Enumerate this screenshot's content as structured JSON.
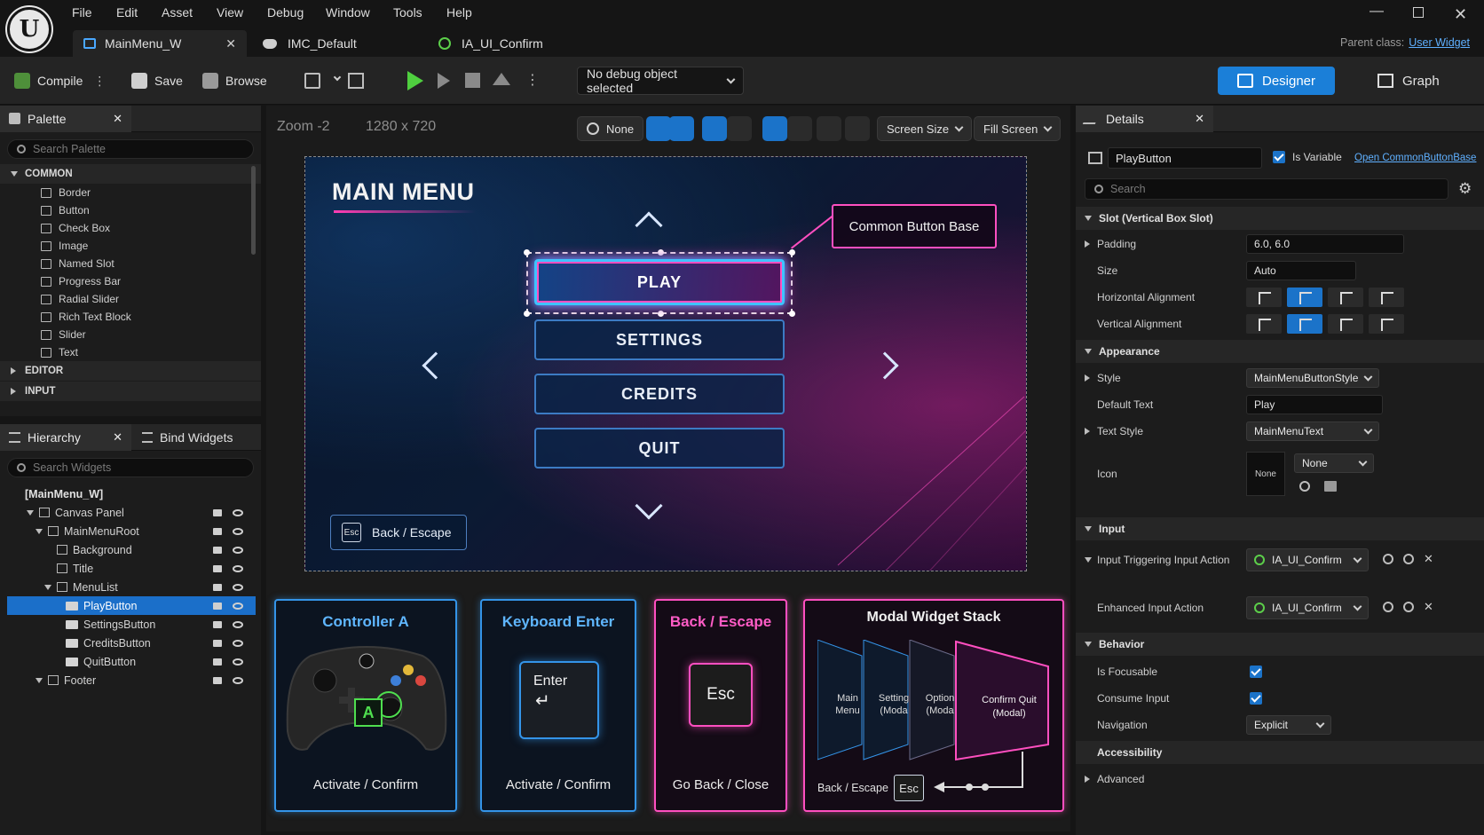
{
  "menu": [
    "File",
    "Edit",
    "Asset",
    "View",
    "Debug",
    "Window",
    "Tools",
    "Help"
  ],
  "tabs": [
    {
      "label": "MainMenu_W",
      "active": true
    },
    {
      "label": "IMC_Default"
    },
    {
      "label": "IA_UI_Confirm"
    }
  ],
  "parent_class": {
    "label": "Parent class:",
    "value": "User Widget"
  },
  "toolbar": {
    "compile": "Compile",
    "save": "Save",
    "browse": "Browse",
    "debug_select": "No debug object selected",
    "designer": "Designer",
    "graph": "Graph"
  },
  "palette": {
    "title": "Palette",
    "search_placeholder": "Search Palette",
    "categories": [
      {
        "name": "COMMON",
        "items": [
          "Border",
          "Button",
          "Check Box",
          "Image",
          "Named Slot",
          "Progress Bar",
          "Radial Slider",
          "Rich Text Block",
          "Slider",
          "Text"
        ]
      },
      {
        "name": "EDITOR"
      },
      {
        "name": "INPUT"
      }
    ]
  },
  "hierarchy": {
    "title": "Hierarchy",
    "bind_tab": "Bind Widgets",
    "search_placeholder": "Search Widgets",
    "root": "[MainMenu_W]",
    "rows": [
      {
        "label": "Canvas Panel",
        "depth": 1
      },
      {
        "label": "MainMenuRoot",
        "depth": 2
      },
      {
        "label": "Background",
        "depth": 3
      },
      {
        "label": "Title",
        "depth": 3
      },
      {
        "label": "MenuList",
        "depth": 3
      },
      {
        "label": "PlayButton",
        "depth": 4,
        "selected": true
      },
      {
        "label": "SettingsButton",
        "depth": 4
      },
      {
        "label": "CreditsButton",
        "depth": 4
      },
      {
        "label": "QuitButton",
        "depth": 4
      },
      {
        "label": "Footer",
        "depth": 2
      }
    ]
  },
  "viewport": {
    "zoom": "Zoom -2",
    "resolution": "1280 x 720",
    "none_label": "None",
    "screen_size": "Screen Size",
    "fill_screen": "Fill Screen"
  },
  "canvas": {
    "title": "MAIN MENU",
    "buttons": [
      "PLAY",
      "SETTINGS",
      "CREDITS",
      "QUIT"
    ],
    "callout": "Common Button Base",
    "back_key": "Esc",
    "back_label": "Back / Escape"
  },
  "cards": {
    "controller": {
      "title": "Controller A",
      "key": "A",
      "caption": "Activate / Confirm"
    },
    "keyboard": {
      "title": "Keyboard Enter",
      "key": "Enter",
      "caption": "Activate / Confirm"
    },
    "back": {
      "title": "Back / Escape",
      "key": "Esc",
      "caption": "Go Back / Close"
    },
    "modal": {
      "title": "Modal Widget Stack",
      "layers": [
        "Main Menu",
        "Setting (Moda",
        "Option (Moda",
        "Confirm Quit (Modal)"
      ],
      "footer_label": "Back / Escape",
      "footer_key": "Esc"
    }
  },
  "details": {
    "title": "Details",
    "widget_name": "PlayButton",
    "is_variable": "Is Variable",
    "open_link": "Open CommonButtonBase",
    "search_placeholder": "Search",
    "slot_category": "Slot (Vertical Box Slot)",
    "padding": {
      "label": "Padding",
      "value": "6.0, 6.0"
    },
    "size": {
      "label": "Size",
      "value": "Auto"
    },
    "h_align": "Horizontal Alignment",
    "v_align": "Vertical Alignment",
    "appearance": "Appearance",
    "style": {
      "label": "Style",
      "value": "MainMenuButtonStyle"
    },
    "default_text": {
      "label": "Default Text",
      "value": "Play"
    },
    "text_style": {
      "label": "Text Style",
      "value": "MainMenuText"
    },
    "icon": {
      "label": "Icon",
      "thumb": "None",
      "value": "None"
    },
    "input": "Input",
    "triggering": {
      "label": "Input Triggering Input Action",
      "value": "IA_UI_Confirm"
    },
    "enhanced": {
      "label": "Enhanced Input Action",
      "value": "IA_UI_Confirm"
    },
    "behavior": "Behavior",
    "is_focusable": "Is Focusable",
    "consume_input": "Consume Input",
    "navigation": {
      "label": "Navigation",
      "value": "Explicit"
    },
    "accessibility": "Accessibility",
    "advanced": "Advanced"
  },
  "colors": {
    "accent_blue": "#1b7fd8",
    "neon_pink": "#ff4fc0",
    "neon_blue": "#3ec3ff"
  }
}
